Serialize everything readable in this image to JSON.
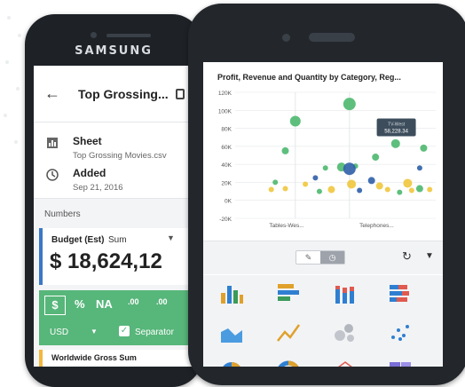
{
  "left_phone": {
    "brand": "SAMSUNG",
    "header": {
      "back_icon": "arrow-left-icon",
      "title": "Top Grossing...",
      "share_icon": "share-icon"
    },
    "info": {
      "sheet_label": "Sheet",
      "sheet_value": "Top Grossing Movies.csv",
      "added_label": "Added",
      "added_value": "Sep 21, 2016"
    },
    "section_label": "Numbers",
    "card": {
      "label": "Budget (Est)",
      "aggregate": "Sum",
      "value": "$ 18,624,12",
      "accent": "#3b78c4"
    },
    "format_bar": {
      "dollar": "$",
      "percent": "%",
      "na": "NA",
      "dec_less": ".00",
      "dec_more": ".00",
      "currency": "USD",
      "separator_label": "Separator",
      "separator_checked": true,
      "color": "#57b67a"
    },
    "next_card": {
      "label": "Worldwide Gross Sum",
      "accent": "#f2b83f"
    }
  },
  "right_phone": {
    "chart_title": "Profit, Revenue and Quantity by Category, Reg...",
    "tooltip": {
      "line1": "TV-West",
      "line2": "58,228.34"
    },
    "toolbar": {
      "refresh_icon": "refresh-icon",
      "caret_icon": "caret-down-icon"
    },
    "gallery_icons": [
      "bar-chart-icon",
      "horizontal-bar-icon",
      "stacked-bar-icon",
      "stacked-horizontal-icon",
      "area-chart-icon",
      "line-chart-icon",
      "bubble-chart-icon",
      "scatter-chart-icon",
      "pie-chart-icon",
      "donut-chart-icon",
      "radar-chart-icon",
      "treemap-icon"
    ]
  },
  "chart_data": {
    "type": "scatter",
    "title": "Profit, Revenue and Quantity by Category, Reg...",
    "y_ticks": [
      "120K",
      "100K",
      "80K",
      "60K",
      "40K",
      "20K",
      "0K",
      "-20K"
    ],
    "ylim": [
      -20000,
      120000
    ],
    "categories": [
      "Tables-Wes...",
      "Telephones..."
    ],
    "points": [
      {
        "x": 0.3,
        "y": 88000,
        "r": 6,
        "color": "#4cb86f"
      },
      {
        "x": 0.57,
        "y": 107000,
        "r": 7,
        "color": "#4cb86f"
      },
      {
        "x": 0.25,
        "y": 55000,
        "r": 4,
        "color": "#4cb86f"
      },
      {
        "x": 0.8,
        "y": 63000,
        "r": 5,
        "color": "#4cb86f"
      },
      {
        "x": 0.7,
        "y": 48000,
        "r": 4,
        "color": "#4cb86f"
      },
      {
        "x": 0.94,
        "y": 58000,
        "r": 4,
        "color": "#4cb86f"
      },
      {
        "x": 0.53,
        "y": 37000,
        "r": 5,
        "color": "#4cb86f"
      },
      {
        "x": 0.45,
        "y": 36000,
        "r": 3,
        "color": "#4cb86f"
      },
      {
        "x": 0.6,
        "y": 38000,
        "r": 3,
        "color": "#4cb86f"
      },
      {
        "x": 0.57,
        "y": 35000,
        "r": 7,
        "color": "#2f5fa8"
      },
      {
        "x": 0.4,
        "y": 25000,
        "r": 3,
        "color": "#2f5fa8"
      },
      {
        "x": 0.68,
        "y": 22000,
        "r": 4,
        "color": "#2f5fa8"
      },
      {
        "x": 0.92,
        "y": 36000,
        "r": 3,
        "color": "#2f5fa8"
      },
      {
        "x": 0.2,
        "y": 20000,
        "r": 3,
        "color": "#4cb86f"
      },
      {
        "x": 0.35,
        "y": 18000,
        "r": 3,
        "color": "#f0c63c"
      },
      {
        "x": 0.58,
        "y": 18000,
        "r": 5,
        "color": "#f0c63c"
      },
      {
        "x": 0.72,
        "y": 16000,
        "r": 4,
        "color": "#f0c63c"
      },
      {
        "x": 0.86,
        "y": 19000,
        "r": 5,
        "color": "#f0c63c"
      },
      {
        "x": 0.25,
        "y": 13000,
        "r": 3,
        "color": "#f0c63c"
      },
      {
        "x": 0.48,
        "y": 12000,
        "r": 4,
        "color": "#f0c63c"
      },
      {
        "x": 0.76,
        "y": 12000,
        "r": 3,
        "color": "#f0c63c"
      },
      {
        "x": 0.88,
        "y": 11000,
        "r": 3,
        "color": "#f0c63c"
      },
      {
        "x": 0.97,
        "y": 12000,
        "r": 3,
        "color": "#f0c63c"
      },
      {
        "x": 0.62,
        "y": 11000,
        "r": 3,
        "color": "#2f5fa8"
      },
      {
        "x": 0.42,
        "y": 10000,
        "r": 3,
        "color": "#4cb86f"
      },
      {
        "x": 0.82,
        "y": 9000,
        "r": 3,
        "color": "#4cb86f"
      },
      {
        "x": 0.92,
        "y": 13000,
        "r": 4,
        "color": "#4cb86f"
      },
      {
        "x": 0.18,
        "y": 12000,
        "r": 3,
        "color": "#f0c63c"
      }
    ]
  }
}
